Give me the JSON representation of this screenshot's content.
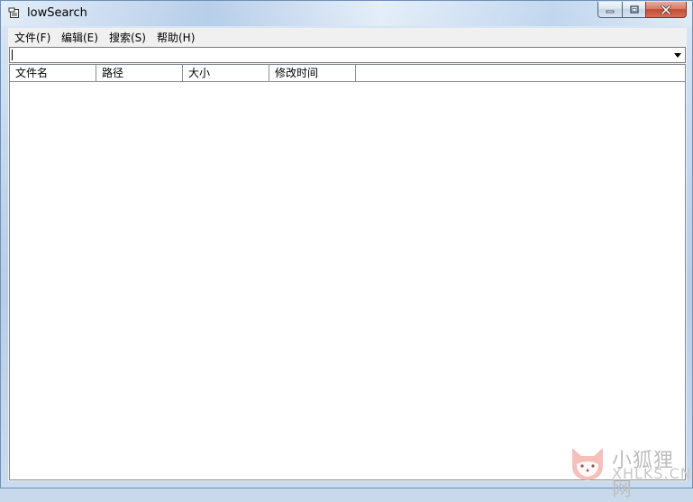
{
  "window": {
    "title": "lowSearch"
  },
  "menubar": {
    "items": [
      {
        "label": "文件(F)"
      },
      {
        "label": "编辑(E)"
      },
      {
        "label": "搜索(S)"
      },
      {
        "label": "帮助(H)"
      }
    ]
  },
  "search": {
    "value": ""
  },
  "listview": {
    "columns": [
      {
        "label": "文件名"
      },
      {
        "label": "路径"
      },
      {
        "label": "大小"
      },
      {
        "label": "修改时间"
      }
    ],
    "rows": []
  },
  "watermark": {
    "text_cn": "小狐狸网",
    "text_en": "XHLKS.CN"
  },
  "colors": {
    "window_border": "#6f8fb5",
    "close_button": "#c44a31",
    "watermark_accent": "#f4a8a8"
  }
}
